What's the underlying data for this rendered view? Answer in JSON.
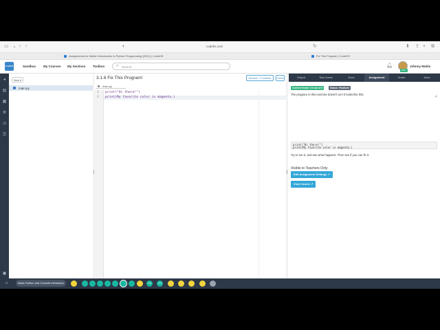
{
  "browser": {
    "url": "codehs.com",
    "tabs": [
      {
        "title": "Assignments for Mattis' Introduction to Python Programming (2021) | CodeHS"
      },
      {
        "title": "Fix This Program | CodeHS"
      }
    ]
  },
  "header": {
    "logo_text": "CodeHS",
    "nav": [
      "Sandbox",
      "My Courses",
      "My Sections",
      "Toolbox"
    ],
    "search_placeholder": "Search...",
    "user_name": "Johnny Mattis",
    "badge": "PRO"
  },
  "files": {
    "new_label": "New",
    "items": [
      "main.py"
    ]
  },
  "editor": {
    "title": "3.1.6 Fix This Program!",
    "submit_label": "Submit + Continue",
    "save_label": "Save",
    "tab_name": "main.py",
    "lines": [
      {
        "num": "1",
        "text": "print(\"Hi there!\")"
      },
      {
        "num": "2",
        "text": "print(My favorite color is magenta.)"
      }
    ]
  },
  "right_panel": {
    "tabs": [
      "Output",
      "Test Cases",
      "Docs",
      "Assignment",
      "Grade",
      "More"
    ],
    "active_tab": "Assignment",
    "grade_badge": "Current Grade: 0.0 out of 0",
    "status_badge": "Status: Finalized",
    "description": "The program in this exercise doesn't run! It looks like this:",
    "code": [
      "print(\"Hi there!\")",
      "print(My favorite color is magenta.)"
    ],
    "instruction": "Try to run it, and see what happens. Then see if you can fix it.",
    "teacher_heading": "Visible to Teachers Only",
    "edit_settings_label": "Edit Assignment Settings",
    "view_course_label": "View Course"
  },
  "bottom_bar": {
    "course_label": "Basic Python and Console Interaction",
    "progress_items": [
      "",
      "",
      "",
      "",
      "",
      "",
      "",
      "",
      "",
      "",
      "",
      "3.3",
      "3.3",
      "",
      "",
      "",
      "",
      ""
    ]
  },
  "colors": {
    "dark_nav": "#2d3848",
    "accent_blue": "#34a7d8",
    "teal": "#18b9a0",
    "yellow": "#f2d43d"
  }
}
